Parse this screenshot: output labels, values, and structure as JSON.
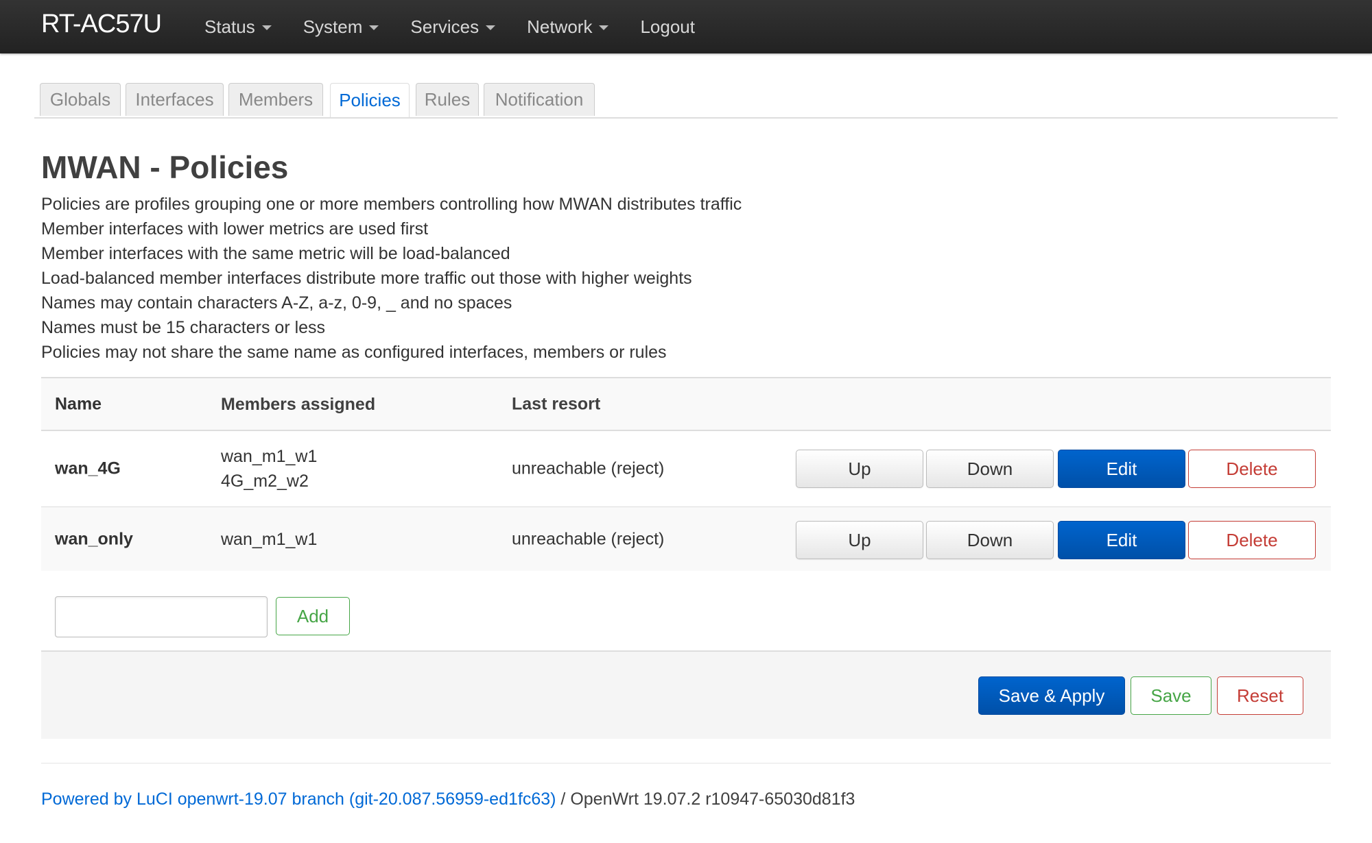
{
  "header": {
    "brand": "RT-AC57U",
    "menu": [
      {
        "label": "Status",
        "has_dropdown": true
      },
      {
        "label": "System",
        "has_dropdown": true
      },
      {
        "label": "Services",
        "has_dropdown": true
      },
      {
        "label": "Network",
        "has_dropdown": true
      },
      {
        "label": "Logout",
        "has_dropdown": false
      }
    ]
  },
  "tabs": [
    {
      "label": "Globals",
      "active": false
    },
    {
      "label": "Interfaces",
      "active": false
    },
    {
      "label": "Members",
      "active": false
    },
    {
      "label": "Policies",
      "active": true
    },
    {
      "label": "Rules",
      "active": false
    },
    {
      "label": "Notification",
      "active": false
    }
  ],
  "page": {
    "title": "MWAN - Policies",
    "description": [
      "Policies are profiles grouping one or more members controlling how MWAN distributes traffic",
      "Member interfaces with lower metrics are used first",
      "Member interfaces with the same metric will be load-balanced",
      "Load-balanced member interfaces distribute more traffic out those with higher weights",
      "Names may contain characters A-Z, a-z, 0-9, _ and no spaces",
      "Names must be 15 characters or less",
      "Policies may not share the same name as configured interfaces, members or rules"
    ]
  },
  "table": {
    "headers": {
      "name": "Name",
      "members": "Members assigned",
      "last_resort": "Last resort"
    },
    "rows": [
      {
        "name": "wan_4G",
        "members": [
          "wan_m1_w1",
          "4G_m2_w2"
        ],
        "last_resort": "unreachable (reject)"
      },
      {
        "name": "wan_only",
        "members": [
          "wan_m1_w1"
        ],
        "last_resort": "unreachable (reject)"
      }
    ],
    "row_actions": {
      "up": "Up",
      "down": "Down",
      "edit": "Edit",
      "delete": "Delete"
    }
  },
  "add": {
    "input_value": "",
    "button_label": "Add"
  },
  "actions": {
    "save_apply": "Save & Apply",
    "save": "Save",
    "reset": "Reset"
  },
  "footer": {
    "link_text": "Powered by LuCI openwrt-19.07 branch (git-20.087.56959-ed1fc63)",
    "separator": " / ",
    "version_text": "OpenWrt 19.07.2 r10947-65030d81f3"
  },
  "colors": {
    "navbar": "#222222",
    "primary": "#0064cd",
    "danger": "#c43c35",
    "success": "#46a546",
    "link": "#0069d6"
  }
}
